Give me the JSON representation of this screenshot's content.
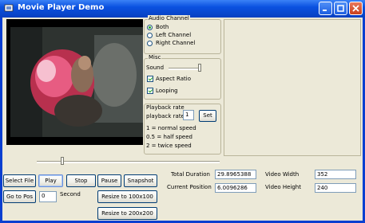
{
  "window": {
    "title": "Movie Player Demo"
  },
  "audio_channel": {
    "label": "Audio Channel",
    "options": [
      "Both",
      "Left Channel",
      "Right Channel"
    ],
    "selected": "Both"
  },
  "misc": {
    "label": "Misc",
    "sound_label": "Sound",
    "aspect_ratio_label": "Aspect Ratio",
    "aspect_ratio_checked": true,
    "looping_label": "Looping",
    "looping_checked": true
  },
  "playback": {
    "group_label": "Playback rate",
    "rate_label": "playback rate",
    "rate_value": "1",
    "set_label": "Set",
    "help_1": "1 = normal speed",
    "help_2": "0.5 = half speed",
    "help_3": "2 = twice speed"
  },
  "buttons": {
    "select_file": "Select File",
    "play": "Play",
    "stop": "Stop",
    "pause": "Pause",
    "snapshot": "Snapshot",
    "go_to_pos": "Go to Pos",
    "resize_100": "Resize to 100x100",
    "resize_200": "Resize to 200x200"
  },
  "goto": {
    "value": "0",
    "unit_label": "Second"
  },
  "info": {
    "total_duration_label": "Total Duration",
    "total_duration": "29.8965388",
    "current_position_label": "Current Position",
    "current_position": "6.0096286",
    "video_width_label": "Video Width",
    "video_width": "352",
    "video_height_label": "Video Height",
    "video_height": "240"
  },
  "colors": {
    "titlebar": "#0a51e0",
    "window_bg": "#ece9d8",
    "accent_check": "#21a121"
  }
}
